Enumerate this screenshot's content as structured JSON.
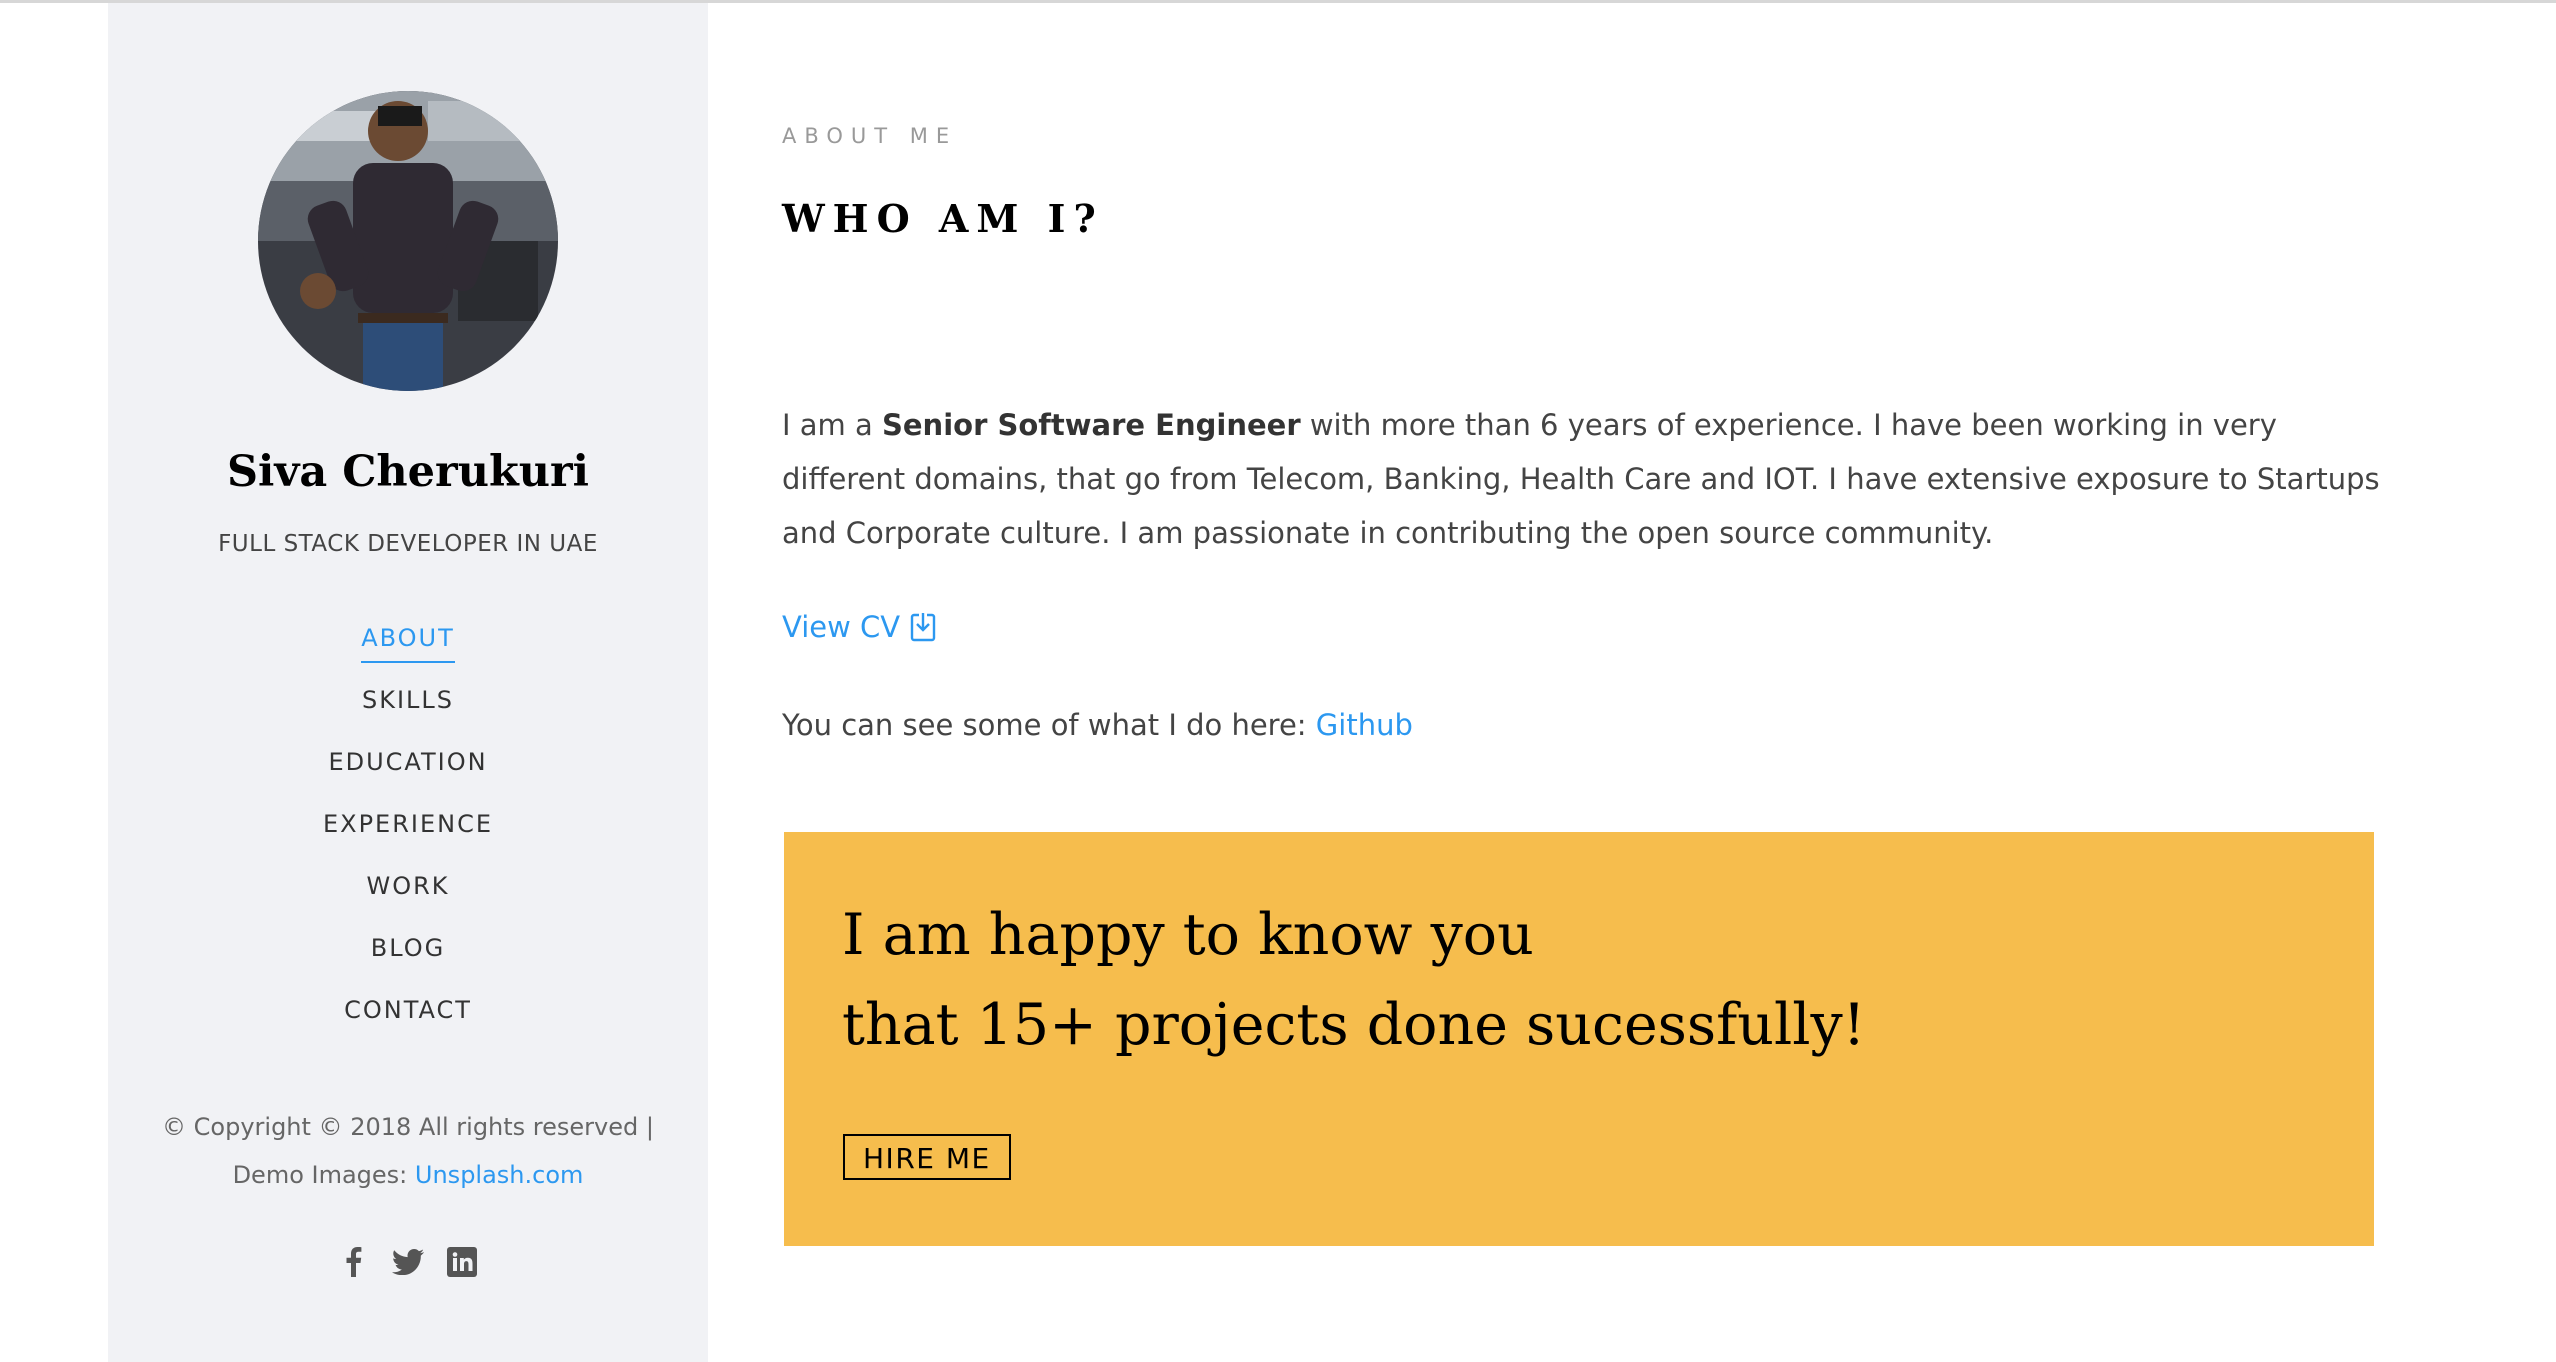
{
  "profile": {
    "name": "Siva Cherukuri",
    "title": "FULL STACK DEVELOPER IN UAE"
  },
  "nav": {
    "items": [
      {
        "label": "ABOUT",
        "active": true
      },
      {
        "label": "SKILLS",
        "active": false
      },
      {
        "label": "EDUCATION",
        "active": false
      },
      {
        "label": "EXPERIENCE",
        "active": false
      },
      {
        "label": "WORK",
        "active": false
      },
      {
        "label": "BLOG",
        "active": false
      },
      {
        "label": "CONTACT",
        "active": false
      }
    ]
  },
  "footer": {
    "copyright": "© Copyright © 2018 All rights reserved |",
    "demo_prefix": "Demo Images: ",
    "demo_link": "Unsplash.com"
  },
  "social": {
    "icons": [
      "facebook-icon",
      "twitter-icon",
      "linkedin-icon"
    ]
  },
  "about": {
    "eyebrow": "ABOUT ME",
    "heading": "WHO AM I?",
    "intro_prefix": "I am a ",
    "intro_bold": "Senior Software Engineer",
    "intro_rest": " with more than 6 years of experience. I have been working in very different domains, that go from Telecom, Banking, Health Care and IOT. I have extensive exposure to Startups and Corporate culture. I am passionate in contributing the open source community.",
    "view_cv": "View CV",
    "github_prefix": "You can see some of what I do here: ",
    "github_link": "Github"
  },
  "banner": {
    "line1": "I am happy to know you",
    "line2": "that 15+ projects done sucessfully!",
    "button": "HIRE ME"
  },
  "colors": {
    "accent": "#2c98f0",
    "banner": "#f6bd4d",
    "sidebar": "#f1f2f5"
  }
}
